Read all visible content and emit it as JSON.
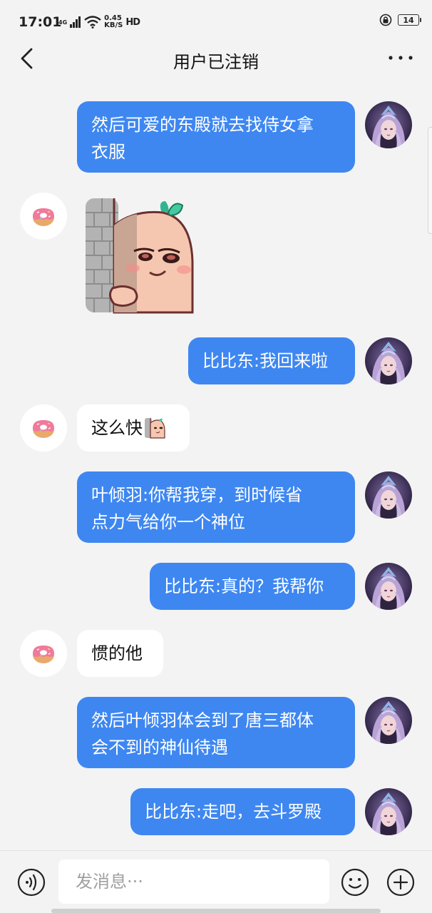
{
  "status_bar": {
    "time": "17:01",
    "network": "4G",
    "speed_value": "0.45",
    "speed_unit": "KB/S",
    "hd": "HD",
    "battery": "14"
  },
  "header": {
    "title": "用户已注销"
  },
  "messages": [
    {
      "side": "out",
      "type": "text",
      "text": "然后可爱的东殿就去找侍女拿\n衣服"
    },
    {
      "side": "in",
      "type": "sticker",
      "sticker": "peeking-potato-sticker"
    },
    {
      "side": "out",
      "type": "text",
      "text": "比比东:我回来啦"
    },
    {
      "side": "in",
      "type": "text",
      "text": "这么快"
    },
    {
      "side": "out",
      "type": "text",
      "text": "叶倾羽:你帮我穿，到时候省\n点力气给你一个神位"
    },
    {
      "side": "out",
      "type": "text",
      "text": "比比东:真的？我帮你"
    },
    {
      "side": "in",
      "type": "text",
      "text": "惯的他"
    },
    {
      "side": "out",
      "type": "text",
      "text": "然后叶倾羽体会到了唐三都体\n会不到的神仙待遇"
    },
    {
      "side": "out",
      "type": "text",
      "text": "比比东:走吧，去斗罗殿"
    }
  ],
  "input_bar": {
    "placeholder": "发消息···",
    "icons": [
      "voice-icon",
      "emoji-icon",
      "plus-icon"
    ]
  },
  "colors": {
    "outgoing_bubble": "#3e87f1",
    "incoming_bubble": "#ffffff",
    "background": "#f3f3f4",
    "donut_pink": "#f07a9c"
  }
}
